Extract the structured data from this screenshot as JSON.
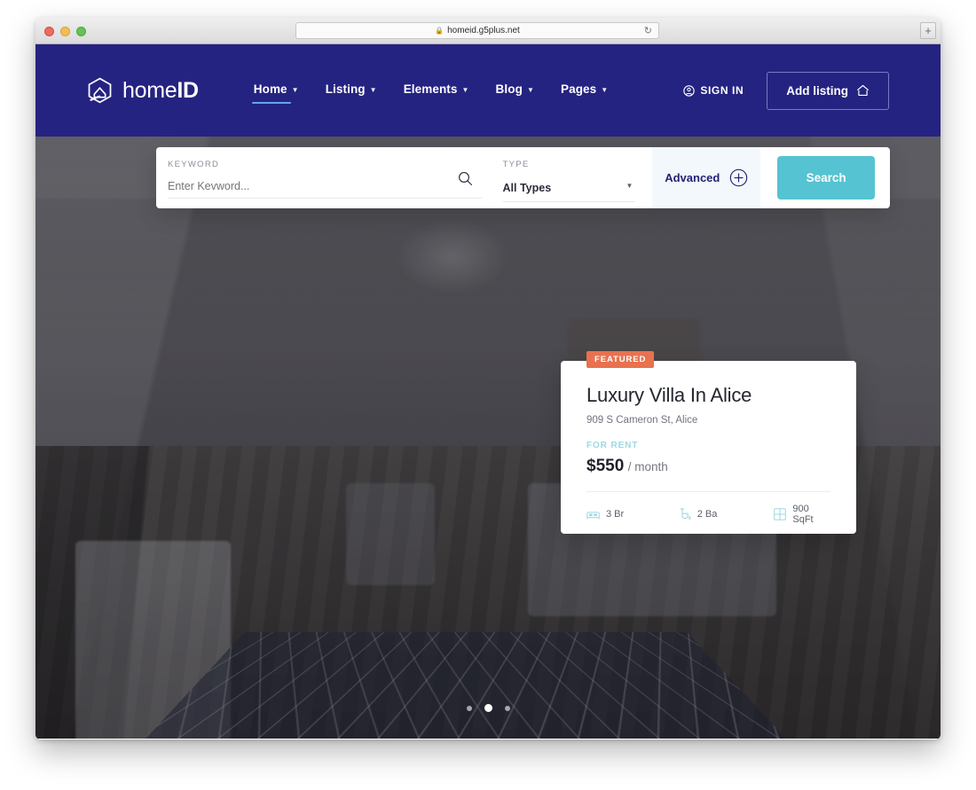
{
  "browser": {
    "url": "homeid.g5plus.net",
    "lock_icon": "lock-icon",
    "reload_icon": "reload-icon",
    "newtab_label": "+"
  },
  "navbar": {
    "logo": {
      "name": "home",
      "bold": "ID"
    },
    "menu": [
      {
        "label": "Home",
        "active": true,
        "caret": "⌄"
      },
      {
        "label": "Listing",
        "active": false,
        "caret": "⌄"
      },
      {
        "label": "Elements",
        "active": false,
        "caret": "⌄"
      },
      {
        "label": "Blog",
        "active": false,
        "caret": "⌄"
      },
      {
        "label": "Pages",
        "active": false,
        "caret": "⌄"
      }
    ],
    "signin_label": "SIGN IN",
    "add_listing_label": "Add listing"
  },
  "search": {
    "keyword_label": "KEYWORD",
    "keyword_placeholder": "Enter Kevword...",
    "keyword_value": "",
    "type_label": "TYPE",
    "type_value": "All Types",
    "type_options": [
      "All Types"
    ],
    "advanced_label": "Advanced",
    "search_button_label": "Search"
  },
  "property_card": {
    "badge": "FEATURED",
    "title": "Luxury Villa In Alice",
    "address": "909 S Cameron St, Alice",
    "status": "FOR RENT",
    "price_amount": "$550",
    "price_period": "/ month",
    "specs": [
      {
        "icon": "bed-icon",
        "value": "3 Br"
      },
      {
        "icon": "shower-icon",
        "value": "2 Ba"
      },
      {
        "icon": "floorplan-icon",
        "value": "900 SqFt"
      }
    ]
  },
  "slider": {
    "dots": 3,
    "active_index": 1
  },
  "colors": {
    "navy": "#252381",
    "teal": "#55c3d2",
    "orange": "#e8714f",
    "accent_underline": "#5fa8e8",
    "light_panel": "#f3f8fc"
  }
}
